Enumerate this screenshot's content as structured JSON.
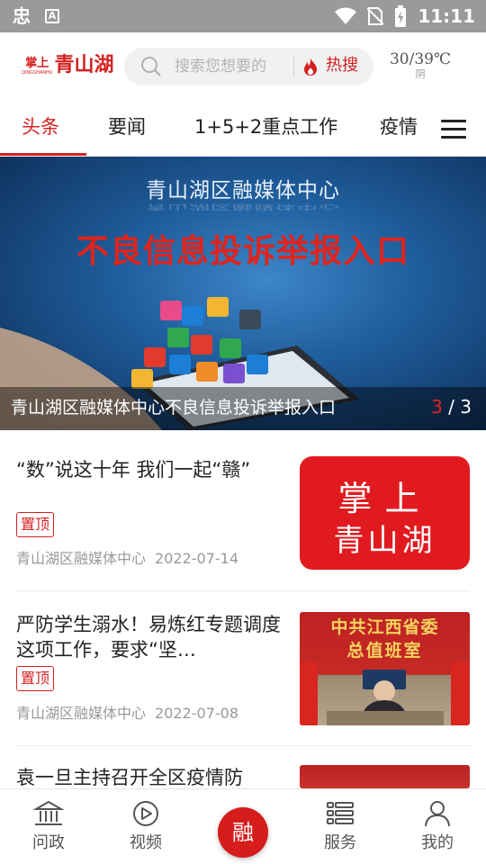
{
  "status_bar": {
    "left_glyph": "忠",
    "a_icon": "A",
    "time": "11:11",
    "icons": [
      "wifi-icon",
      "no-sim-icon",
      "battery-charging-icon"
    ]
  },
  "header": {
    "logo_small_text": "掌上",
    "logo_small_sub": "QINGSHANHU",
    "logo_text": "青山湖",
    "search_placeholder": "搜索您想要的",
    "hot_label": "热搜",
    "weather_temp": "30/39℃",
    "weather_condition": "阴"
  },
  "tabs": [
    {
      "label": "头条",
      "active": true
    },
    {
      "label": "要闻",
      "active": false
    },
    {
      "label": "1+5+2重点工作",
      "active": false
    },
    {
      "label": "疫情",
      "active": false
    }
  ],
  "banner": {
    "org_text": "青山湖区融媒体中心",
    "headline": "不良信息投诉举报入口",
    "caption": "青山湖区融媒体中心不良信息投诉举报入口",
    "page_current": "3",
    "page_sep": " / ",
    "page_total": "3"
  },
  "feed": [
    {
      "title": "“数”说这十年 我们一起“赣”",
      "badge": "置顶",
      "source": "青山湖区融媒体中心",
      "date": "2022-07-14",
      "thumb_line1": "掌上",
      "thumb_line2": "青山湖"
    },
    {
      "title": "严防学生溺水！易炼红专题调度这项工作，要求“坚…",
      "badge": "置顶",
      "source": "青山湖区融媒体中心",
      "date": "2022-07-08",
      "thumb_line1": "中共江西省委",
      "thumb_line2": "总值班室"
    },
    {
      "title": "袁一旦主持召开全区疫情防"
    }
  ],
  "bottom_nav": [
    {
      "label": "问政",
      "icon": "government-building-icon"
    },
    {
      "label": "视频",
      "icon": "play-circle-icon"
    },
    {
      "label": "融",
      "icon": "center-fab"
    },
    {
      "label": "服务",
      "icon": "service-list-icon"
    },
    {
      "label": "我的",
      "icon": "user-icon"
    }
  ],
  "colors": {
    "accent": "#d42020",
    "status_bar": "#9a9a9a"
  }
}
